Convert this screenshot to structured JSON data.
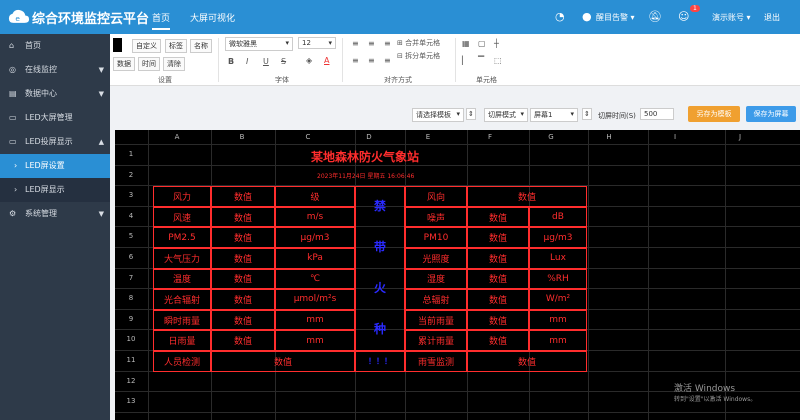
{
  "header": {
    "title": "综合环境监控云平台",
    "tabs": [
      "首页",
      "大屏可视化"
    ],
    "alert_label": "醒目告警",
    "notif_count": "1",
    "account_label": "演示账号",
    "logout_label": "退出"
  },
  "sidebar": {
    "items": [
      "首页",
      "在线监控",
      "数据中心",
      "LED大屏管理",
      "LED投屏显示"
    ],
    "sub_items": [
      "LED屏设置",
      "LED屏显示"
    ],
    "last": "系统管理"
  },
  "ribbon": {
    "custom": "自定义",
    "tag": "标签",
    "name": "名称",
    "data": "数据",
    "time": "时间",
    "clear": "清除",
    "group_setting": "设置",
    "font_family": "微软雅黑",
    "font_size": "12",
    "bold": "B",
    "italic": "I",
    "underline": "U",
    "strike": "S",
    "font_color_sym": "A",
    "group_font": "字体",
    "group_align": "对齐方式",
    "merge": "合并单元格",
    "split": "拆分单元格",
    "group_cell": "单元格"
  },
  "toolbar2": {
    "template_sel": "请选择模板",
    "switch_mode": "切屏模式",
    "screen": "屏幕1",
    "switch_time_label": "切屏时间(S)",
    "switch_time_value": "500",
    "save_template": "另存为模板",
    "save_screen": "保存为屏幕"
  },
  "sheet": {
    "columns": [
      "A",
      "B",
      "C",
      "D",
      "E",
      "F",
      "G",
      "H",
      "I",
      "J"
    ],
    "rows": [
      "1",
      "2",
      "3",
      "4",
      "5",
      "6",
      "7",
      "8",
      "9",
      "10",
      "11",
      "12",
      "13"
    ],
    "title": "某地森林防火气象站",
    "date": "2023年11月24日 星期五 16:06:46",
    "left_table": [
      [
        "风力",
        "数值",
        "级"
      ],
      [
        "风速",
        "数值",
        "m/s"
      ],
      [
        "PM2.5",
        "数值",
        "μg/m3"
      ],
      [
        "大气压力",
        "数值",
        "kPa"
      ],
      [
        "温度",
        "数值",
        "℃"
      ],
      [
        "光合辐射",
        "数值",
        "μmol/m²s"
      ],
      [
        "瞬时雨量",
        "数值",
        "mm"
      ],
      [
        "日雨量",
        "数值",
        "mm"
      ]
    ],
    "right_table": [
      [
        "风向",
        "数值",
        ""
      ],
      [
        "噪声",
        "数值",
        "dB"
      ],
      [
        "PM10",
        "数值",
        "μg/m3"
      ],
      [
        "光照度",
        "数值",
        "Lux"
      ],
      [
        "湿度",
        "数值",
        "%RH"
      ],
      [
        "总辐射",
        "数值",
        "W/m²"
      ],
      [
        "当前雨量",
        "数值",
        "mm"
      ],
      [
        "累计雨量",
        "数值",
        "mm"
      ]
    ],
    "vertical": [
      "禁",
      "带",
      "火",
      "种"
    ],
    "row11": [
      "人员检测",
      "数值",
      "！！！",
      "雨雪监测",
      "数值"
    ]
  },
  "watermark": {
    "line1": "激活 Windows",
    "line2": "转到\"设置\"以激活 Windows。"
  }
}
